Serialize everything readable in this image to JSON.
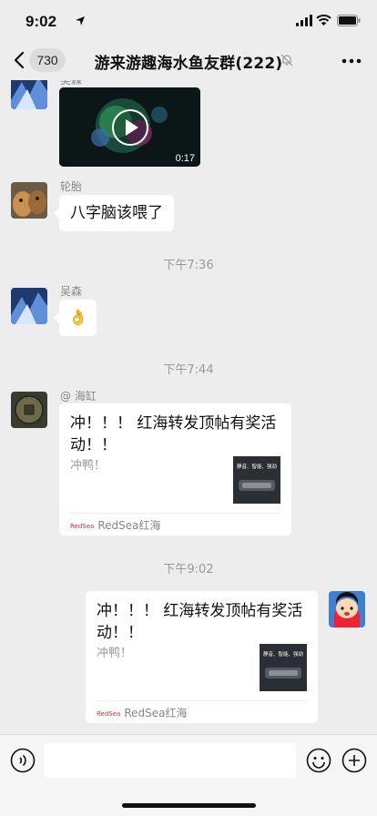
{
  "status_bar": {
    "time": "9:02"
  },
  "nav": {
    "badge": "730",
    "title": "游来游趣海水鱼友群(222)"
  },
  "messages": {
    "top_sender": "吴森",
    "video_duration": "0:17",
    "msg1_sender": "轮胎",
    "msg1_text": "八字脑该喂了",
    "time1": "下午7:36",
    "msg2_sender": "吴森",
    "msg2_text": "👌",
    "time2": "下午7:44",
    "msg3_sender": "@ 海缸",
    "card1": {
      "title": "冲！！！ 红海转发顶帖有奖活动！！",
      "desc": "冲鸭！",
      "source": "RedSea红海",
      "logo_text": "RedSea",
      "thumb_text": "静音、智能、强劲"
    },
    "time3": "下午9:02",
    "card2": {
      "title": "冲！！！ 红海转发顶帖有奖活动！！",
      "desc": "冲鸭！",
      "source": "RedSea红海",
      "logo_text": "RedSea",
      "thumb_text": "静音、智能、强劲"
    }
  },
  "colors": {
    "background": "#ededed",
    "bubble": "#ffffff",
    "timestamp": "#999999"
  }
}
